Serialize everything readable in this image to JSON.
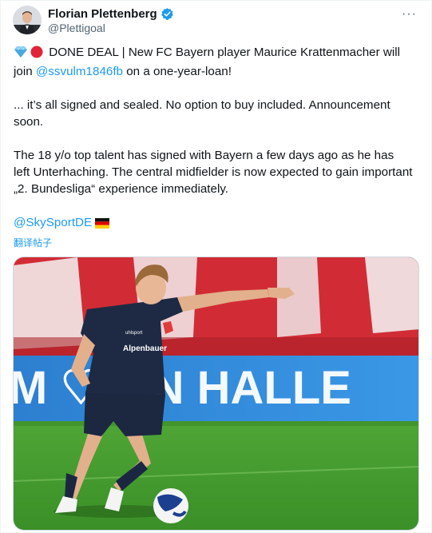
{
  "author": {
    "display_name": "Florian Plettenberg",
    "handle": "@Plettigoal",
    "verified": true
  },
  "menu": {
    "more_label": "···"
  },
  "tweet": {
    "line1_prefix": "DONE DEAL | New FC Bayern player Maurice Krattenmacher will join ",
    "line1_mention": "@ssvulm1846fb",
    "line1_suffix": " on a one-year-loan!",
    "paragraph2": "... it’s all signed and sealed. No option to buy included. Announcement soon.",
    "paragraph3": "The 18 y/o top talent has signed with Bayern a few days ago as he has left Unterhaching. The central midfielder is now expected to gain important „2. Bundesliga“ experience immediately.",
    "footer_mention": "@SkySportDE",
    "emojis": [
      "gem-icon",
      "red-circle-icon",
      "germany-flag-icon"
    ]
  },
  "translate_label": "翻译帖子",
  "media": {
    "banner_text": "M ♡ ON HALLE",
    "shirt_sponsor": "Alpenbauer",
    "shirt_brand": "uhlsport"
  },
  "colors": {
    "accent": "#1d9bf0",
    "text": "#0f1419",
    "muted": "#536471"
  }
}
